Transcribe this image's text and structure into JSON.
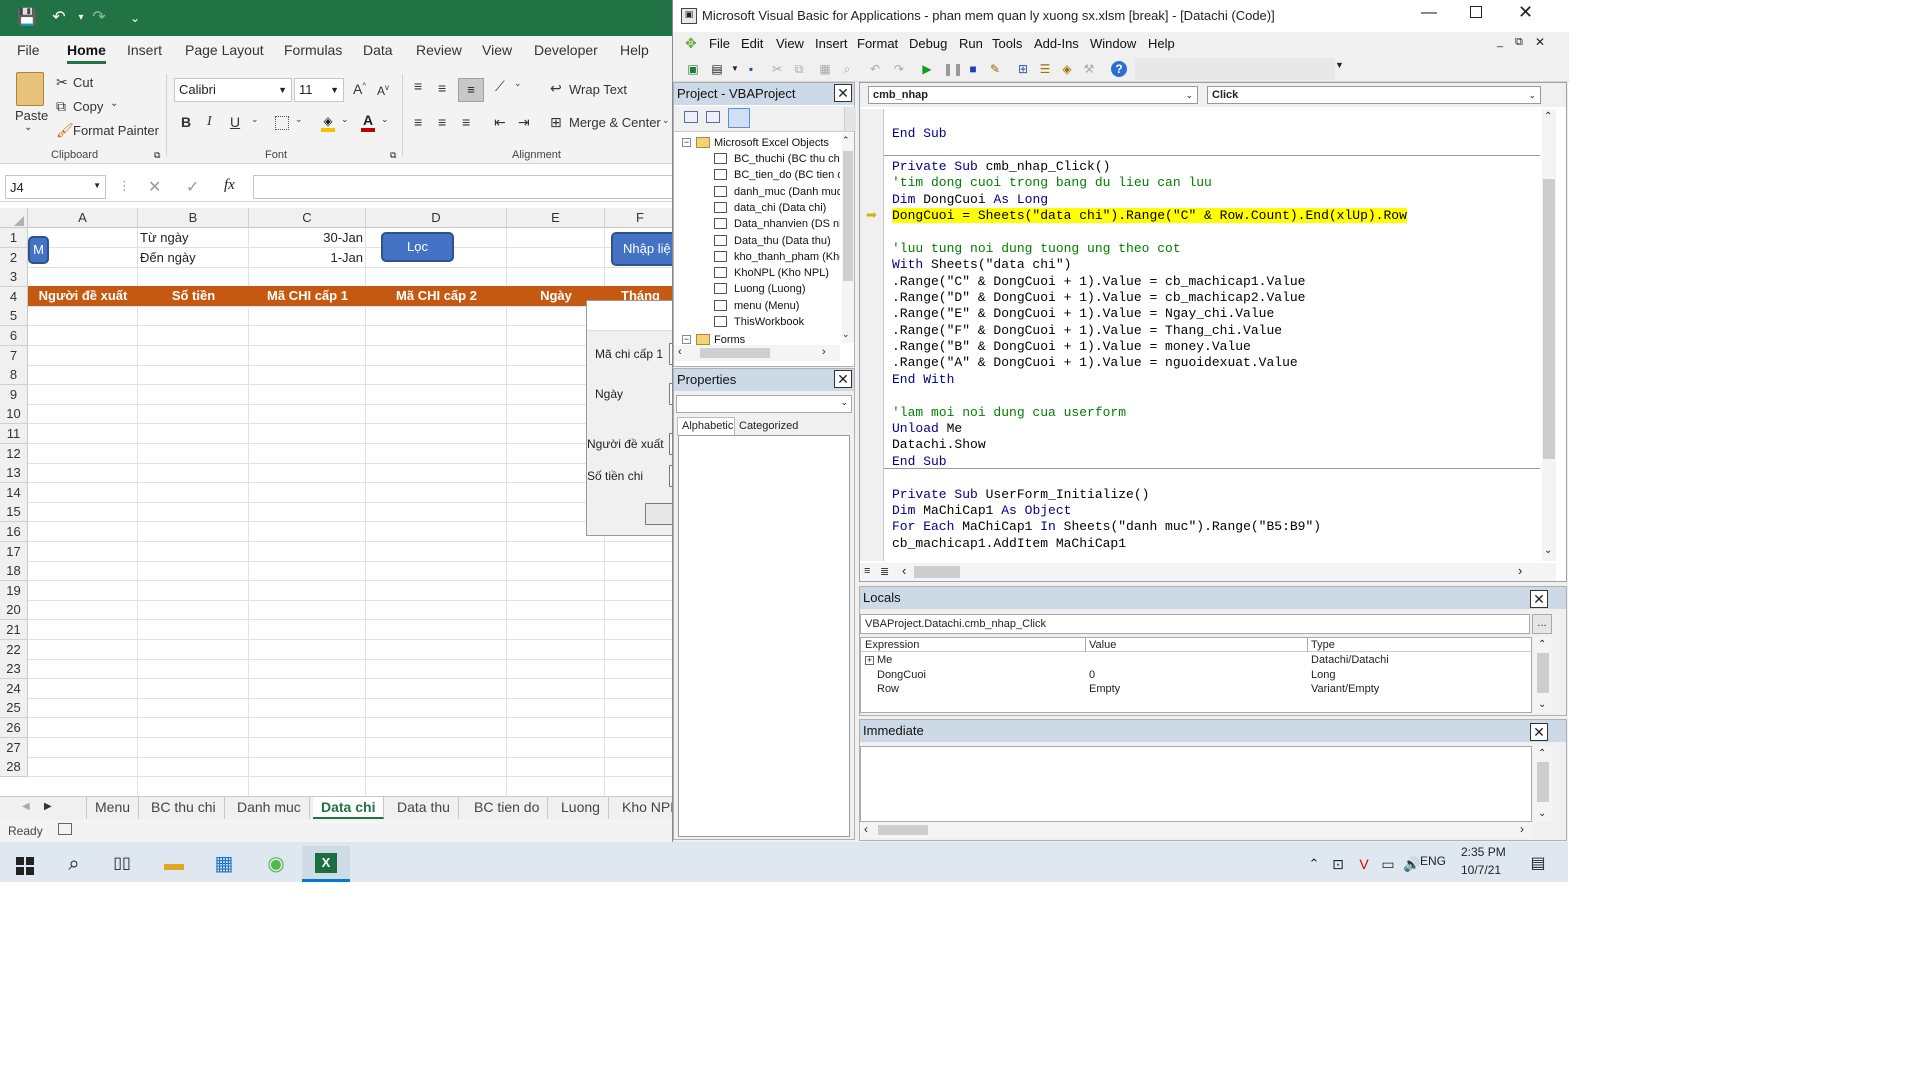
{
  "excel": {
    "qat": {
      "save": "💾",
      "undo": "↶",
      "redo": "↷",
      "more": "⌄"
    },
    "tabs": [
      "File",
      "Home",
      "Insert",
      "Page Layout",
      "Formulas",
      "Data",
      "Review",
      "View",
      "Developer",
      "Help"
    ],
    "ribbon": {
      "paste": "Paste",
      "cut": "Cut",
      "copy": "Copy",
      "format_painter": "Format Painter",
      "font_name": "Calibri",
      "font_size": "11",
      "wrap_text": "Wrap Text",
      "merge_center": "Merge & Center",
      "groups": {
        "clipboard": "Clipboard",
        "font": "Font",
        "alignment": "Alignment"
      }
    },
    "name_box": "J4",
    "fx": "fx",
    "columns": [
      "A",
      "B",
      "C",
      "D",
      "E",
      "F"
    ],
    "rows": [
      "1",
      "2",
      "3",
      "4",
      "5",
      "6",
      "7",
      "8",
      "9",
      "10",
      "11",
      "12",
      "13",
      "14",
      "15",
      "16",
      "17",
      "18",
      "19",
      "20",
      "21",
      "22",
      "23",
      "24",
      "25",
      "26",
      "27",
      "28"
    ],
    "cells": {
      "b1": "Từ ngày",
      "c1": "30-Jan",
      "b2": "Đến ngày",
      "c2": "1-Jan"
    },
    "header_row": [
      "Người đề xuất",
      "Số tiền",
      "Mã CHI cấp 1",
      "Mã CHI cấp 2",
      "Ngày",
      "Tháng"
    ],
    "buttons": {
      "m": "M",
      "loc": "Lọc",
      "nhap": "Nhập liệ"
    },
    "userform": {
      "labels": [
        "Mã chi cấp 1",
        "Ngày",
        "Người đề xuất",
        "Số tiền chi"
      ]
    },
    "sheet_tabs": [
      "Menu",
      "BC thu chi",
      "Danh muc",
      "Data chi",
      "Data thu",
      "BC tien do",
      "Luong",
      "Kho NPL"
    ],
    "active_sheet": "Data chi",
    "status": "Ready"
  },
  "vbe": {
    "title": "Microsoft Visual Basic for Applications - phan mem quan ly xuong sx.xlsm [break] - [Datachi (Code)]",
    "menu": [
      "File",
      "Edit",
      "View",
      "Insert",
      "Format",
      "Debug",
      "Run",
      "Tools",
      "Add-Ins",
      "Window",
      "Help"
    ],
    "project": {
      "title": "Project - VBAProject",
      "folder_excel": "Microsoft Excel Objects",
      "items": [
        "BC_thuchi (BC thu chi",
        "BC_tien_do (BC tien d",
        "danh_muc (Danh muc",
        "data_chi (Data chi)",
        "Data_nhanvien (DS nh",
        "Data_thu (Data thu)",
        "kho_thanh_pham (Kho",
        "KhoNPL (Kho NPL)",
        "Luong (Luong)",
        "menu (Menu)",
        "ThisWorkbook"
      ],
      "folder_forms": "Forms"
    },
    "properties": {
      "title": "Properties",
      "tab_alpha": "Alphabetic",
      "tab_cat": "Categorized"
    },
    "code": {
      "object": "cmb_nhap",
      "procedure": "Click",
      "lines": [
        [
          {
            "t": "End Sub",
            "c": "kw"
          }
        ],
        [],
        [
          {
            "t": "Private Sub ",
            "c": "kw"
          },
          {
            "t": "cmb_nhap_Click()",
            "c": ""
          }
        ],
        [
          {
            "t": "'tim dong cuoi trong bang du lieu can luu",
            "c": "cm"
          }
        ],
        [
          {
            "t": "Dim ",
            "c": "kw"
          },
          {
            "t": "DongCuoi ",
            "c": ""
          },
          {
            "t": "As Long",
            "c": "kw"
          }
        ],
        [
          {
            "t": "DongCuoi = Sheets(\"data chi\").Range(\"C\" & Row.Count).End(xlUp).Row",
            "c": "hl"
          }
        ],
        [],
        [
          {
            "t": "'luu tung noi dung tuong ung theo cot",
            "c": "cm"
          }
        ],
        [
          {
            "t": "With ",
            "c": "kw"
          },
          {
            "t": "Sheets(\"data chi\")",
            "c": ""
          }
        ],
        [
          {
            "t": ".Range(\"C\" & DongCuoi + 1).Value = cb_machicap1.Value",
            "c": ""
          }
        ],
        [
          {
            "t": ".Range(\"D\" & DongCuoi + 1).Value = cb_machicap2.Value",
            "c": ""
          }
        ],
        [
          {
            "t": ".Range(\"E\" & DongCuoi + 1).Value = Ngay_chi.Value",
            "c": ""
          }
        ],
        [
          {
            "t": ".Range(\"F\" & DongCuoi + 1).Value = Thang_chi.Value",
            "c": ""
          }
        ],
        [
          {
            "t": ".Range(\"B\" & DongCuoi + 1).Value = money.Value",
            "c": ""
          }
        ],
        [
          {
            "t": ".Range(\"A\" & DongCuoi + 1).Value = nguoidexuat.Value",
            "c": ""
          }
        ],
        [
          {
            "t": "End With",
            "c": "kw"
          }
        ],
        [],
        [
          {
            "t": "'lam moi noi dung cua userform",
            "c": "cm"
          }
        ],
        [
          {
            "t": "Unload ",
            "c": "kw"
          },
          {
            "t": "Me",
            "c": ""
          }
        ],
        [
          {
            "t": "Datachi.Show",
            "c": ""
          }
        ],
        [
          {
            "t": "End Sub",
            "c": "kw"
          }
        ],
        [],
        [
          {
            "t": "Private Sub ",
            "c": "kw"
          },
          {
            "t": "UserForm_Initialize()",
            "c": ""
          }
        ],
        [
          {
            "t": "Dim ",
            "c": "kw"
          },
          {
            "t": "MaChiCap1 ",
            "c": ""
          },
          {
            "t": "As Object",
            "c": "kw"
          }
        ],
        [
          {
            "t": "For Each ",
            "c": "kw"
          },
          {
            "t": "MaChiCap1 ",
            "c": ""
          },
          {
            "t": "In ",
            "c": "kw"
          },
          {
            "t": "Sheets(\"danh muc\").Range(\"B5:B9\")",
            "c": ""
          }
        ],
        [
          {
            "t": "cb_machicap1.AddItem MaChiCap1",
            "c": ""
          }
        ]
      ]
    },
    "locals": {
      "title": "Locals",
      "context": "VBAProject.Datachi.cmb_nhap_Click",
      "more": "...",
      "columns": [
        "Expression",
        "Value",
        "Type"
      ],
      "rows": [
        {
          "expr": "Me",
          "value": "",
          "type": "Datachi/Datachi"
        },
        {
          "expr": "DongCuoi",
          "value": "0",
          "type": "Long"
        },
        {
          "expr": "Row",
          "value": "Empty",
          "type": "Variant/Empty"
        }
      ]
    },
    "immediate": {
      "title": "Immediate"
    }
  },
  "taskbar": {
    "time": "2:35 PM",
    "date": "10/7/21",
    "lang": "ENG"
  }
}
